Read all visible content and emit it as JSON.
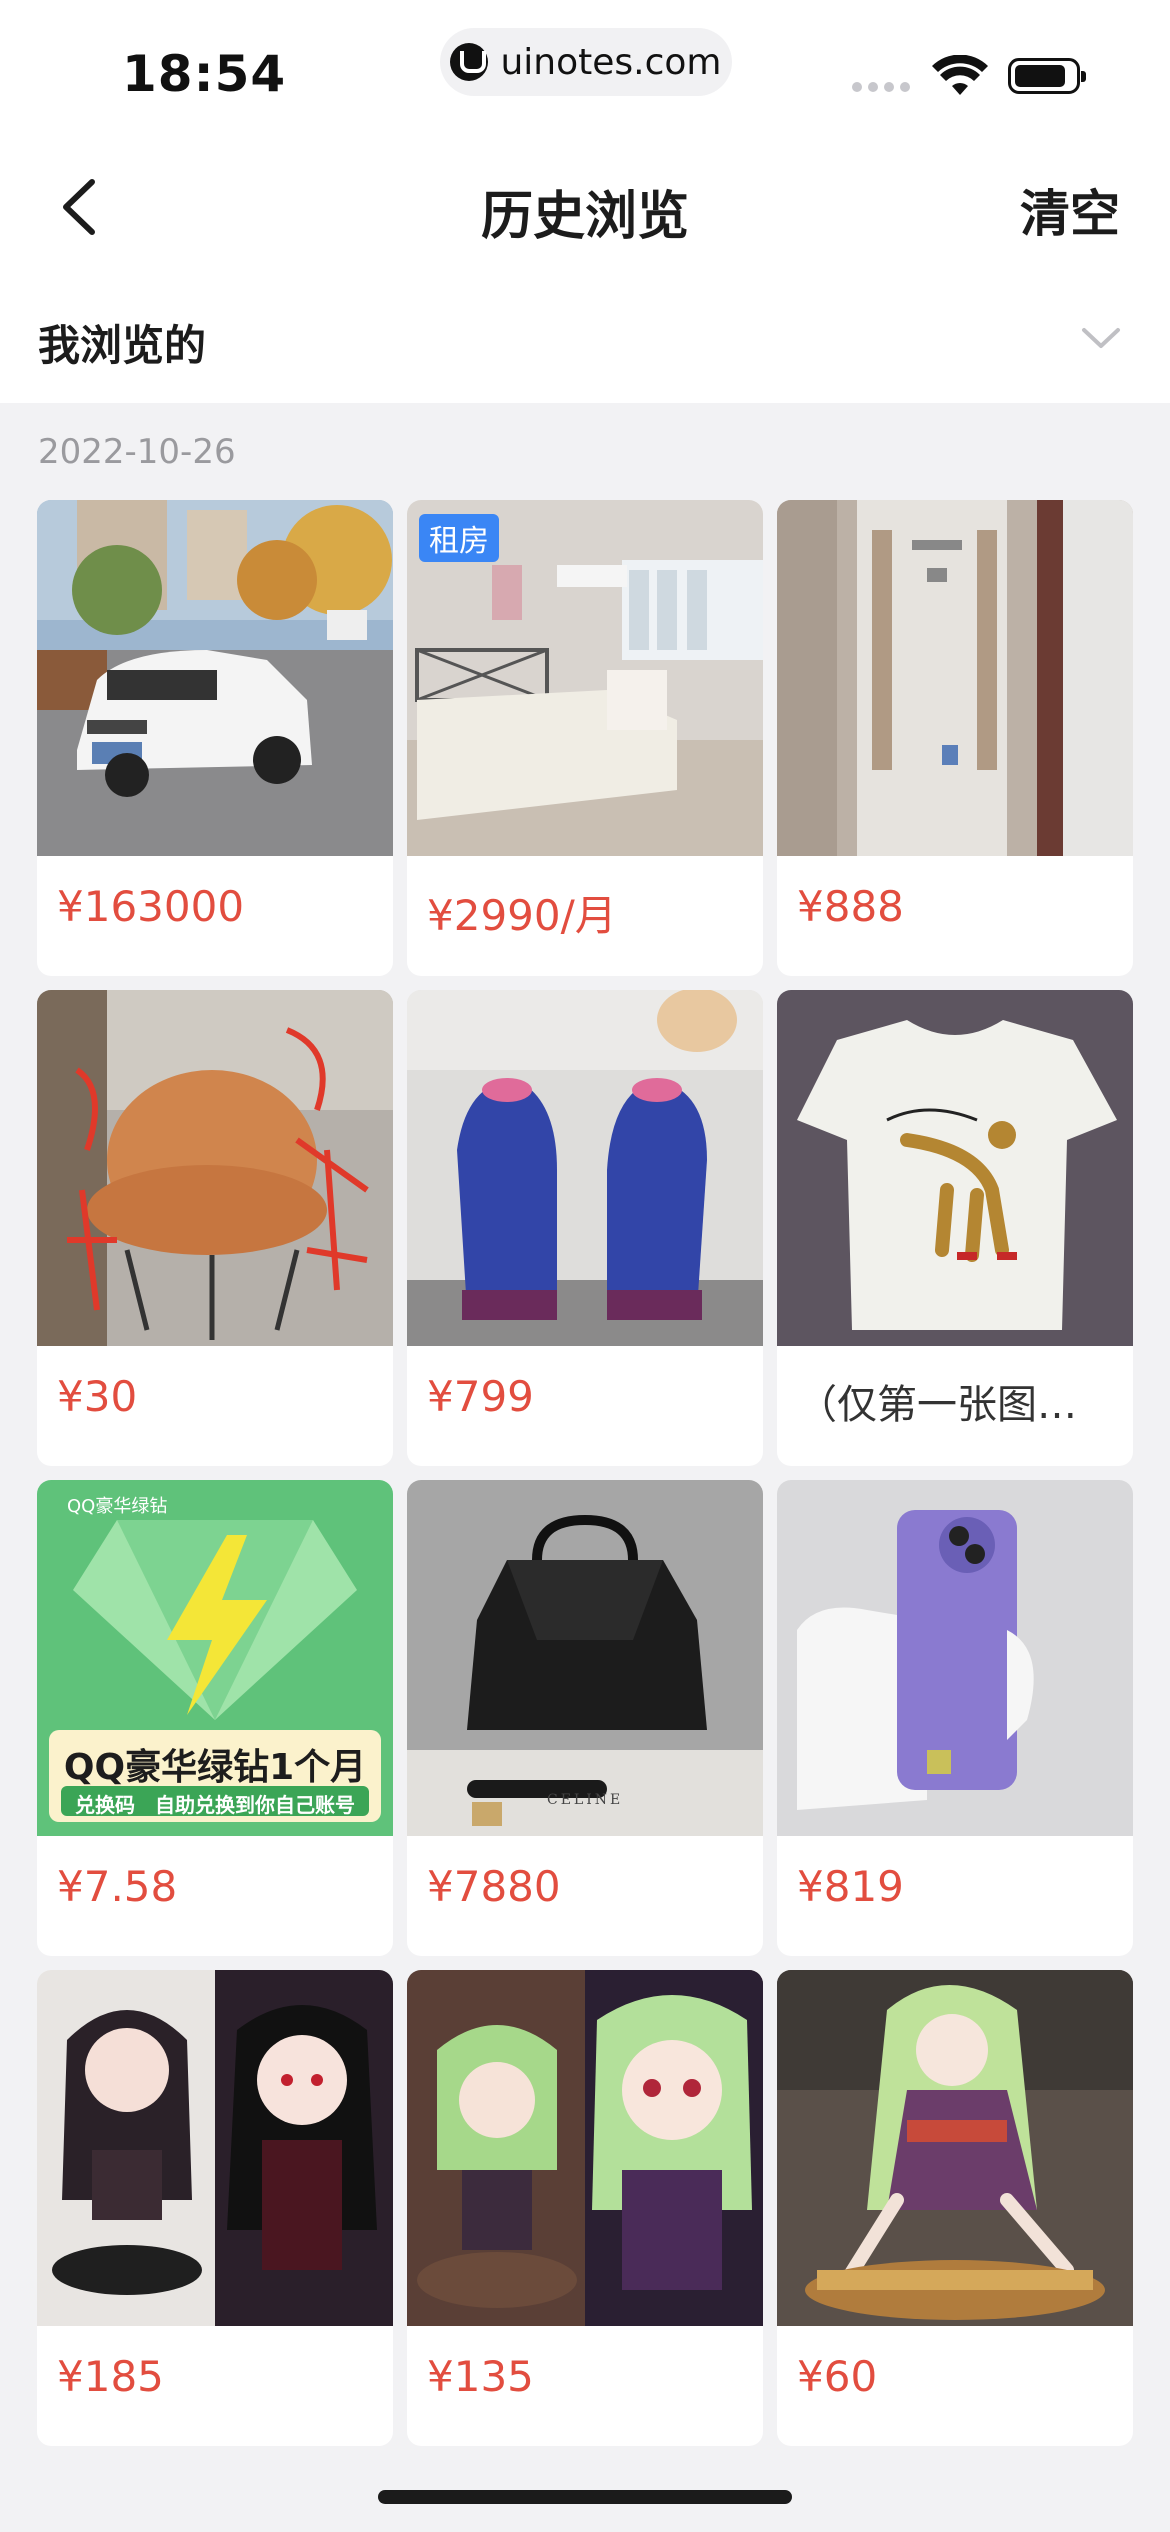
{
  "status_bar": {
    "time": "18:54",
    "url": "uinotes.com"
  },
  "nav": {
    "title": "历史浏览",
    "clear_label": "清空"
  },
  "filter": {
    "label": "我浏览的"
  },
  "section": {
    "date": "2022-10-26"
  },
  "items": [
    {
      "price": "¥163000",
      "image": "white-suv-car",
      "tag": ""
    },
    {
      "price": "¥2990/月",
      "image": "rental-bedroom",
      "tag": "租房"
    },
    {
      "price": "¥888",
      "image": "standing-air-conditioner",
      "tag": ""
    },
    {
      "price": "¥30",
      "image": "orange-leather-chair",
      "tag": ""
    },
    {
      "price": "¥799",
      "image": "blue-running-shoes",
      "tag": ""
    },
    {
      "title": "（仅第一张图…",
      "image": "cat-print-tshirt",
      "tag": ""
    },
    {
      "price": "¥7.58",
      "image": "qq-green-diamond-card",
      "tag": "",
      "overlay_title": "QQ豪华绿钻1个月",
      "overlay_sub": "兑换码　自助兑换到你自己账号",
      "overlay_brand": "QQ豪华绿钻"
    },
    {
      "price": "¥7880",
      "image": "black-handbag",
      "tag": "",
      "overlay_brand": "CELINE"
    },
    {
      "price": "¥819",
      "image": "purple-phone",
      "tag": ""
    },
    {
      "price": "¥185",
      "image": "anime-figure-black-hair",
      "tag": ""
    },
    {
      "price": "¥135",
      "image": "anime-figure-green-hair",
      "tag": ""
    },
    {
      "price": "¥60",
      "image": "anime-figure-kimono",
      "tag": ""
    }
  ],
  "colors": {
    "price": "#e24d3f",
    "tag_bg": "#3a86f5",
    "page_bg": "#f2f2f4"
  }
}
